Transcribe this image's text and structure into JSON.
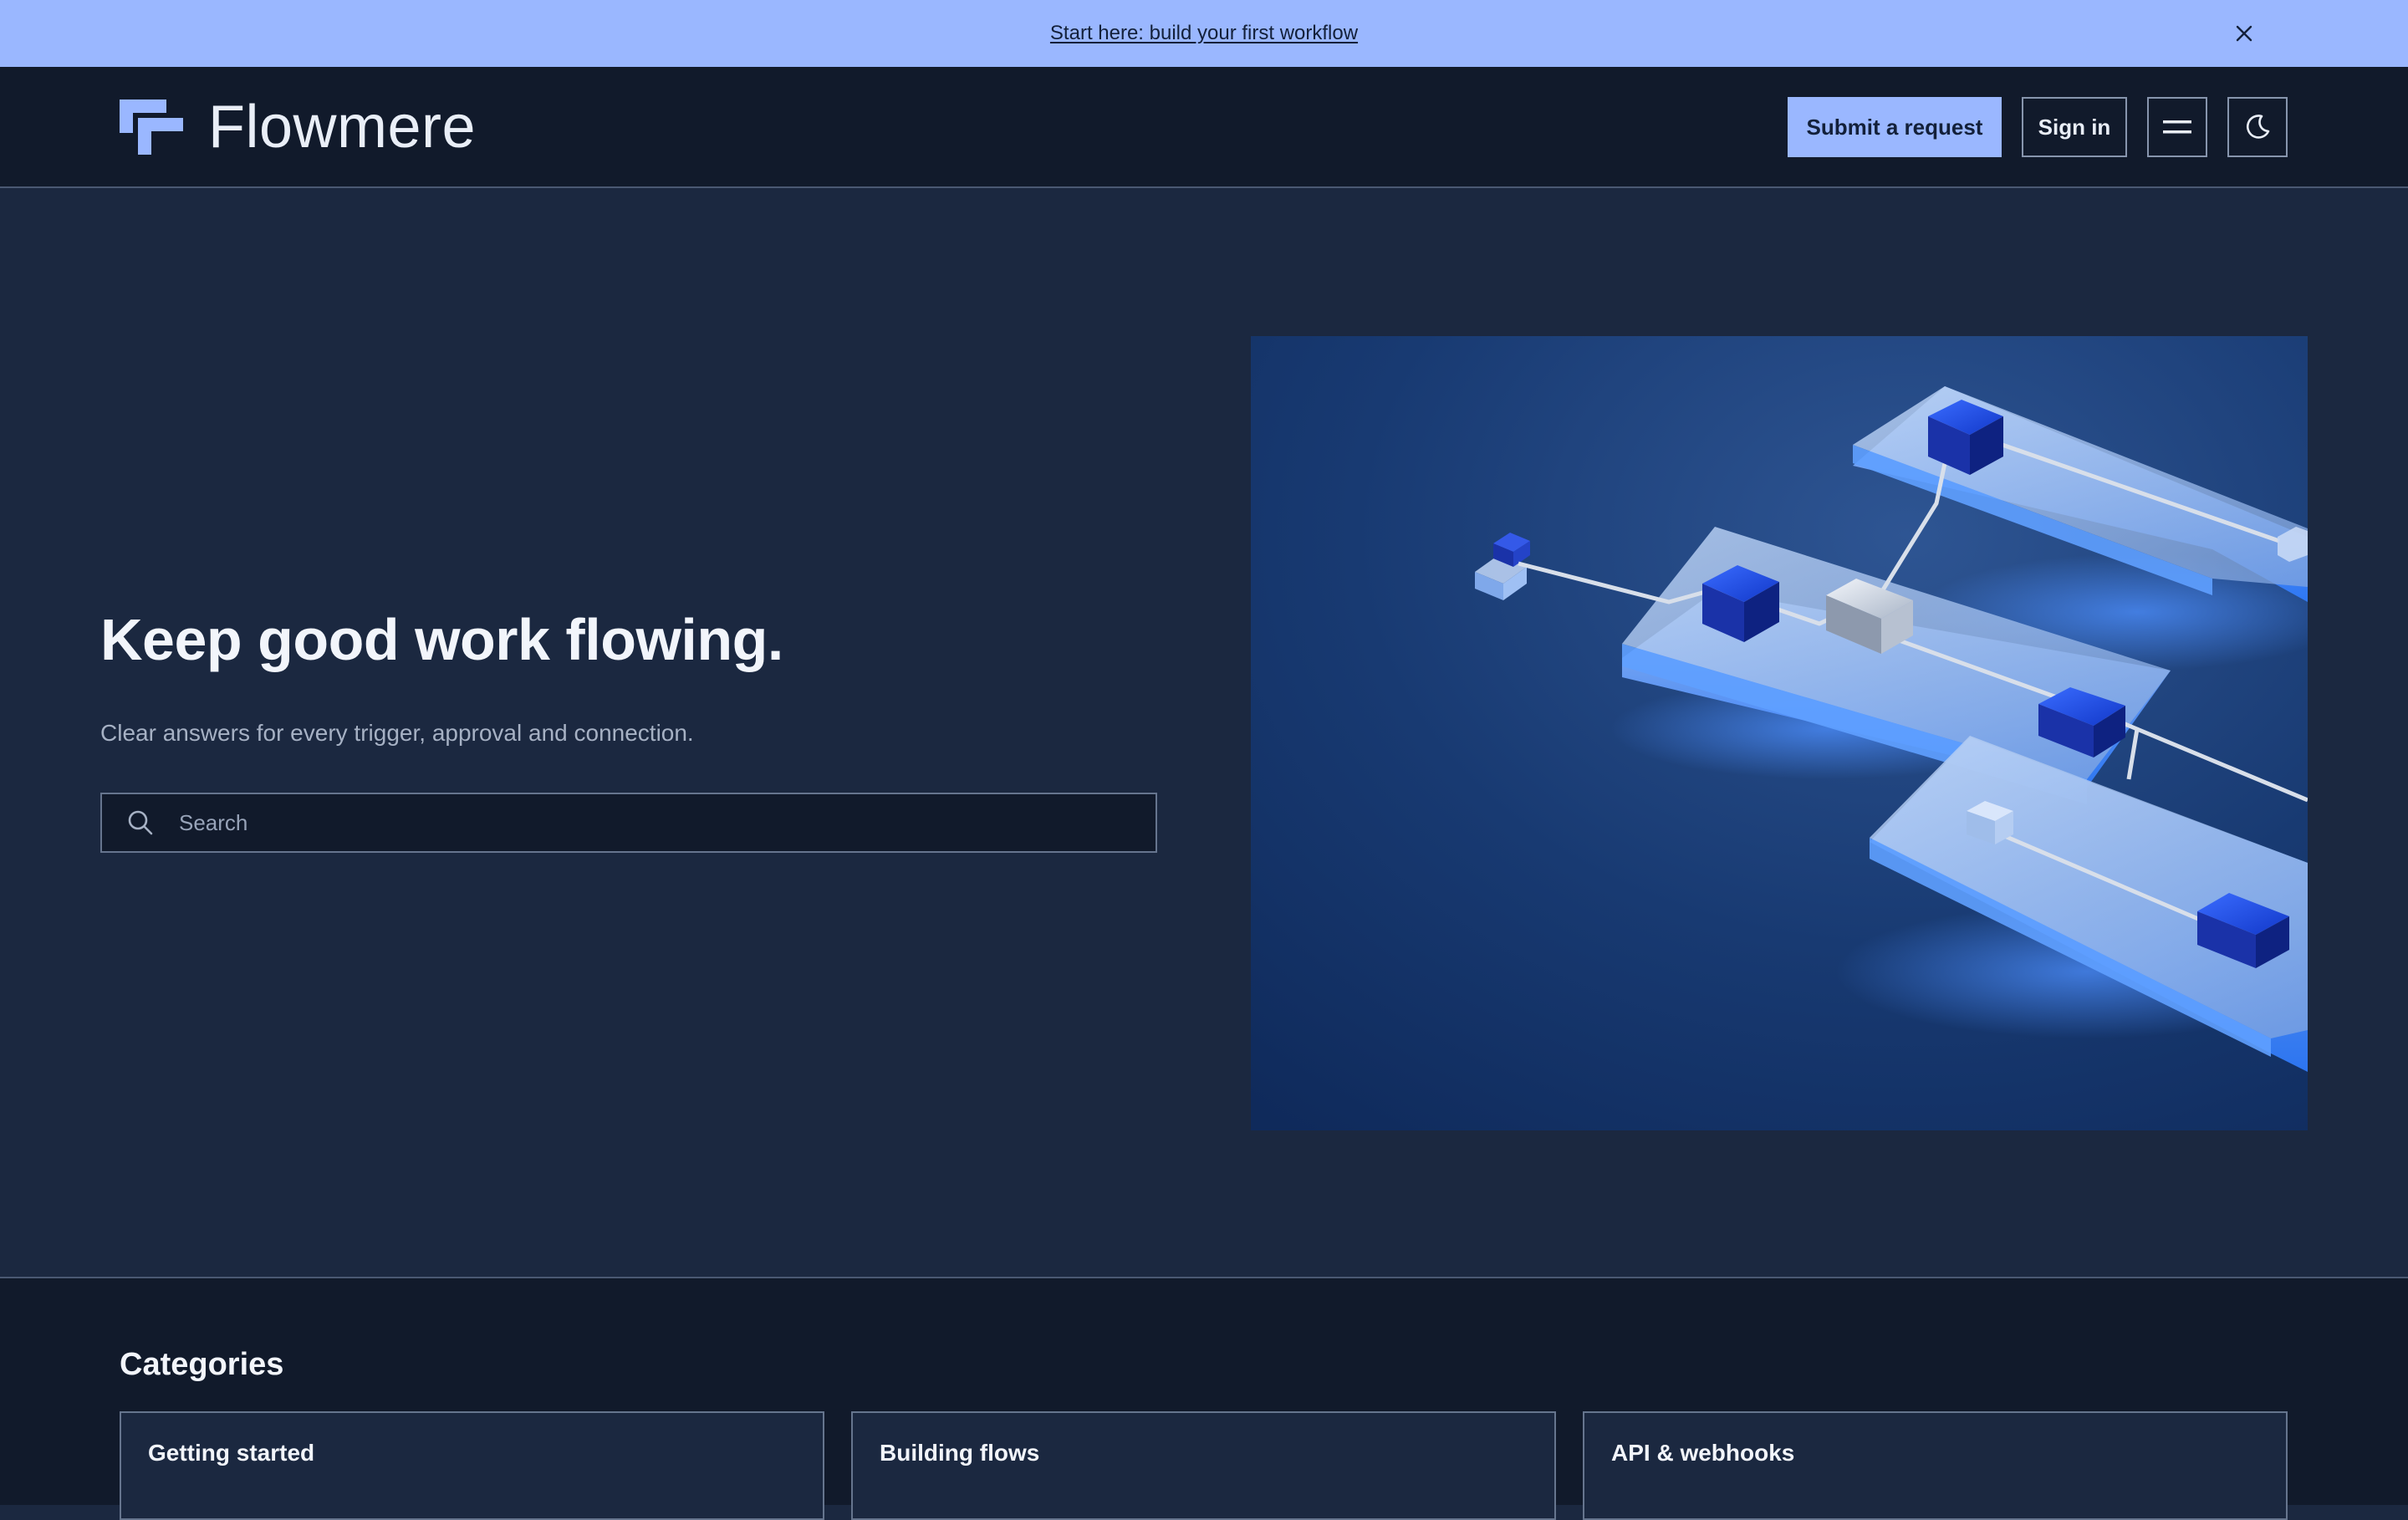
{
  "announcement": {
    "link_text": "Start here: build your first workflow"
  },
  "header": {
    "logo_text": "Flowmere",
    "submit_label": "Submit a request",
    "signin_label": "Sign in"
  },
  "hero": {
    "title": "Keep good work flowing.",
    "subtitle": "Clear answers for every trigger, approval and connection.",
    "search_placeholder": "Search"
  },
  "categories": {
    "heading": "Categories",
    "items": [
      {
        "label": "Getting started"
      },
      {
        "label": "Building flows"
      },
      {
        "label": "API & webhooks"
      }
    ]
  },
  "colors": {
    "accent": "#9ab7ff",
    "header_bg": "#111a2b",
    "hero_bg": "#1b2840"
  },
  "icons": {
    "close": "close-icon",
    "menu": "menu-icon",
    "theme": "moon-icon",
    "search": "search-icon",
    "logo": "logo-icon"
  }
}
